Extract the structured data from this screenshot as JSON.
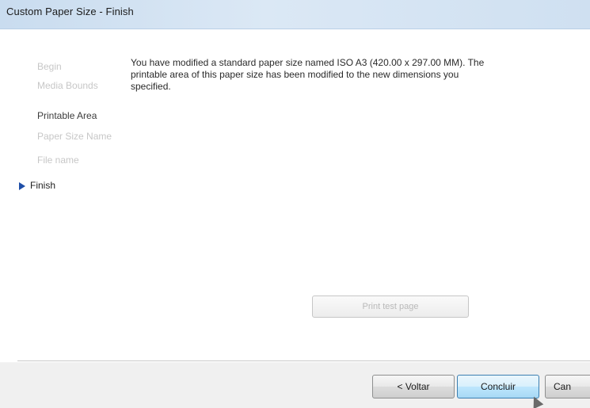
{
  "window": {
    "title": "Custom Paper Size - Finish"
  },
  "steps": [
    {
      "label": "Begin",
      "state": "dim"
    },
    {
      "label": "Media Bounds",
      "state": "dim"
    },
    {
      "label": "Printable Area",
      "state": "done"
    },
    {
      "label": "Paper Size Name",
      "state": "dim"
    },
    {
      "label": "File name",
      "state": "dim"
    },
    {
      "label": "Finish",
      "state": "current"
    }
  ],
  "message": "You have modified a standard paper size named ISO A3 (420.00 x 297.00 MM). The printable area of this paper size has been modified to the new dimensions you specified.",
  "buttons": {
    "print_test": "Print test page",
    "back": "< Voltar",
    "finish": "Concluir",
    "cancel": "Can"
  },
  "colors": {
    "accent": "#1f4fa8",
    "finish_button_border": "#3c7fb1"
  }
}
